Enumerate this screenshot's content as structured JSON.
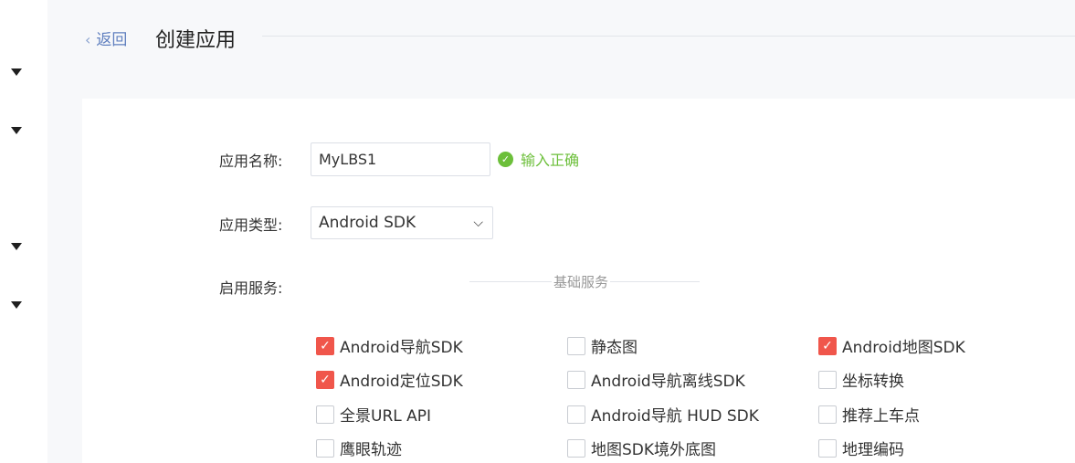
{
  "header": {
    "back_label": "返回",
    "back_chevron": "‹",
    "title": "创建应用"
  },
  "form": {
    "name_label": "应用名称:",
    "name_value": "MyLBS1",
    "name_valid_text": "输入正确",
    "type_label": "应用类型:",
    "type_value": "Android SDK",
    "services_label": "启用服务:",
    "section_title": "基础服务"
  },
  "services": [
    {
      "label": "Android导航SDK",
      "checked": true
    },
    {
      "label": "静态图",
      "checked": false
    },
    {
      "label": "Android地图SDK",
      "checked": true
    },
    {
      "label": "Android定位SDK",
      "checked": true
    },
    {
      "label": "Android导航离线SDK",
      "checked": false
    },
    {
      "label": "坐标转换",
      "checked": false
    },
    {
      "label": "全景URL API",
      "checked": false
    },
    {
      "label": "Android导航 HUD SDK",
      "checked": false
    },
    {
      "label": "推荐上车点",
      "checked": false
    },
    {
      "label": "鹰眼轨迹",
      "checked": false
    },
    {
      "label": "地图SDK境外底图",
      "checked": false
    },
    {
      "label": "地理编码",
      "checked": false
    }
  ],
  "colors": {
    "accent_checked": "#f0564b",
    "valid_green": "#6cbf3a",
    "link_blue": "#5f7fbf"
  },
  "icons": {
    "sidebar_toggle": "caret-down-icon",
    "select_caret": "chevron-down-icon",
    "valid": "check-circle-icon",
    "checkbox_check": "check-icon"
  }
}
